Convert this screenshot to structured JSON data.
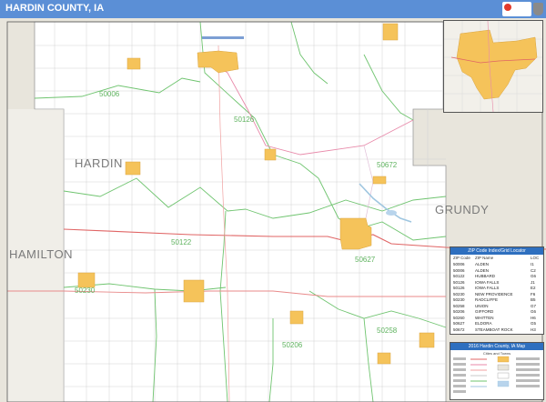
{
  "header": {
    "title": "HARDIN COUNTY, IA"
  },
  "colors": {
    "title_bar": "#5b8fd6",
    "county_fill": "#ffffff",
    "outside_fill": "#e8e5dc",
    "city_fill": "#f5c35a",
    "zip_boundary": "#6fc46f",
    "highway": "#e06464",
    "road_minor": "#c8c8c8",
    "county_label": "#7a7a7a"
  },
  "map": {
    "county_labels": {
      "hardin": "HARDIN",
      "grundy": "GRUNDY",
      "hamilton": "HAMILTON"
    },
    "zip_labels": [
      "50006",
      "50126",
      "50672",
      "50122",
      "50627",
      "50230",
      "50206",
      "50258"
    ]
  },
  "legend": {
    "title": "ZIP Code Index/Grid Locator",
    "headers": {
      "zip": "ZIP Code",
      "name": "ZIP Name",
      "loc": "LOC"
    },
    "rows": [
      {
        "zip": "50006",
        "name": "ALDEN",
        "loc": "I1"
      },
      {
        "zip": "50006",
        "name": "ALDEN",
        "loc": "C2"
      },
      {
        "zip": "50122",
        "name": "HUBBARD",
        "loc": "G6"
      },
      {
        "zip": "50126",
        "name": "IOWA FALLS",
        "loc": "J1"
      },
      {
        "zip": "50126",
        "name": "IOWA FALLS",
        "loc": "E2"
      },
      {
        "zip": "50230",
        "name": "NEW PROVIDENCE",
        "loc": "F6"
      },
      {
        "zip": "50230",
        "name": "RADCLIFFE",
        "loc": "B5"
      },
      {
        "zip": "50258",
        "name": "UNION",
        "loc": "G7"
      },
      {
        "zip": "50206",
        "name": "GIFFORD",
        "loc": "G6"
      },
      {
        "zip": "50260",
        "name": "WHITTEN",
        "loc": "H6"
      },
      {
        "zip": "50627",
        "name": "ELDORA",
        "loc": "G5"
      },
      {
        "zip": "50672",
        "name": "STEAMBOAT ROCK",
        "loc": "H3"
      }
    ]
  },
  "map_key": {
    "title": "2016 Hardin County, IA Map",
    "subtitle": "Cities and Towns"
  }
}
